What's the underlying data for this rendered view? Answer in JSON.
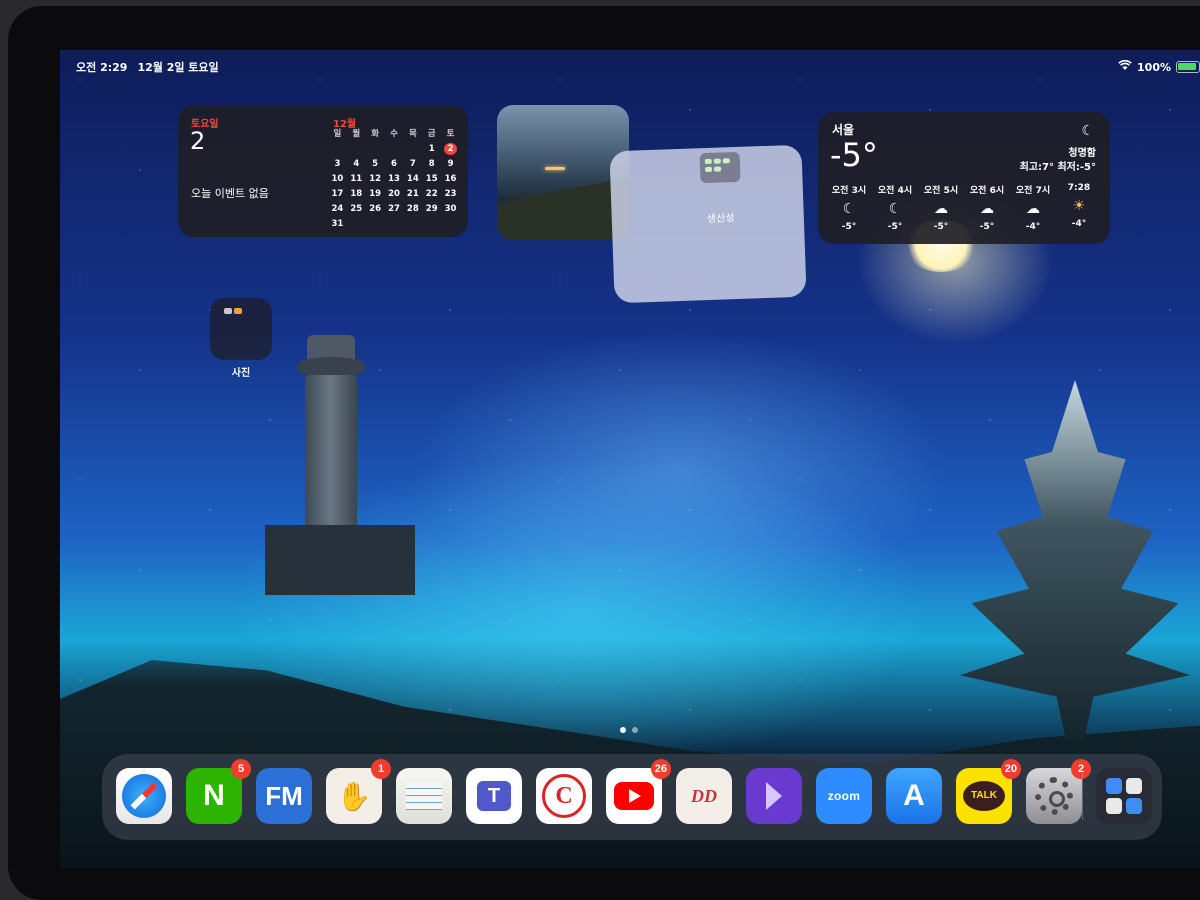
{
  "status_bar": {
    "time": "오전 2:29",
    "date": "12월 2일 토요일",
    "battery": "100%",
    "battery_level": 1.0,
    "wifi_icon": "wifi-icon"
  },
  "calendar_widget": {
    "weekday": "토요일",
    "day": "2",
    "no_events": "오늘 이벤트 없음",
    "month": "12월",
    "days_of_week": [
      "일",
      "월",
      "화",
      "수",
      "목",
      "금",
      "토"
    ],
    "today": "2",
    "weeks": [
      [
        "",
        "",
        "",
        "",
        "",
        "1",
        "2"
      ],
      [
        "3",
        "4",
        "5",
        "6",
        "7",
        "8",
        "9"
      ],
      [
        "10",
        "11",
        "12",
        "13",
        "14",
        "15",
        "16"
      ],
      [
        "17",
        "18",
        "19",
        "20",
        "21",
        "22",
        "23"
      ],
      [
        "24",
        "25",
        "26",
        "27",
        "28",
        "29",
        "30"
      ],
      [
        "31",
        "",
        "",
        "",
        "",
        "",
        ""
      ]
    ]
  },
  "productivity_folder": {
    "label": "생산성"
  },
  "weather_widget": {
    "city": "서울",
    "temperature": "-5°",
    "condition": "청명함",
    "high_low": "최고:7° 최저:-5°",
    "icon": "moon-icon",
    "hourly": [
      {
        "time": "오전 3시",
        "icon": "moon-icon",
        "temp": "-5°"
      },
      {
        "time": "오전 4시",
        "icon": "moon-icon",
        "temp": "-5°"
      },
      {
        "time": "오전 5시",
        "icon": "moon-cloud-icon",
        "temp": "-5°"
      },
      {
        "time": "오전 6시",
        "icon": "moon-cloud-icon",
        "temp": "-5°"
      },
      {
        "time": "오전 7시",
        "icon": "cloud-icon",
        "temp": "-4°"
      },
      {
        "time": "7:28",
        "icon": "sunrise-icon",
        "temp": "-4°"
      }
    ]
  },
  "photos_folder": {
    "label": "사진"
  },
  "dock": {
    "apps": [
      {
        "name": "safari",
        "icon": "safari-icon",
        "badge": ""
      },
      {
        "name": "naver",
        "icon": "naver-icon",
        "label": "N",
        "badge": "5"
      },
      {
        "name": "fm",
        "icon": "fm-icon",
        "label": "FM",
        "badge": ""
      },
      {
        "name": "paint",
        "icon": "hand-paint-icon",
        "badge": "1"
      },
      {
        "name": "notes",
        "icon": "notes-pen-icon",
        "badge": ""
      },
      {
        "name": "teams",
        "icon": "teams-icon",
        "label": "T",
        "badge": ""
      },
      {
        "name": "class",
        "icon": "c-logo-icon",
        "label": "C",
        "badge": ""
      },
      {
        "name": "youtube",
        "icon": "youtube-icon",
        "badge": "26"
      },
      {
        "name": "doodle",
        "icon": "doodle-icon",
        "label": "DD",
        "badge": ""
      },
      {
        "name": "keynote",
        "icon": "keynote-icon",
        "badge": ""
      },
      {
        "name": "zoom",
        "icon": "zoom-icon",
        "label": "zoom",
        "badge": ""
      },
      {
        "name": "app-store",
        "icon": "app-store-icon",
        "label": "A",
        "badge": ""
      },
      {
        "name": "kakaotalk",
        "icon": "kakaotalk-icon",
        "label": "TALK",
        "badge": "20"
      },
      {
        "name": "settings",
        "icon": "gear-icon",
        "badge": "2"
      },
      {
        "name": "app-library",
        "icon": "app-library-icon",
        "badge": ""
      }
    ]
  }
}
